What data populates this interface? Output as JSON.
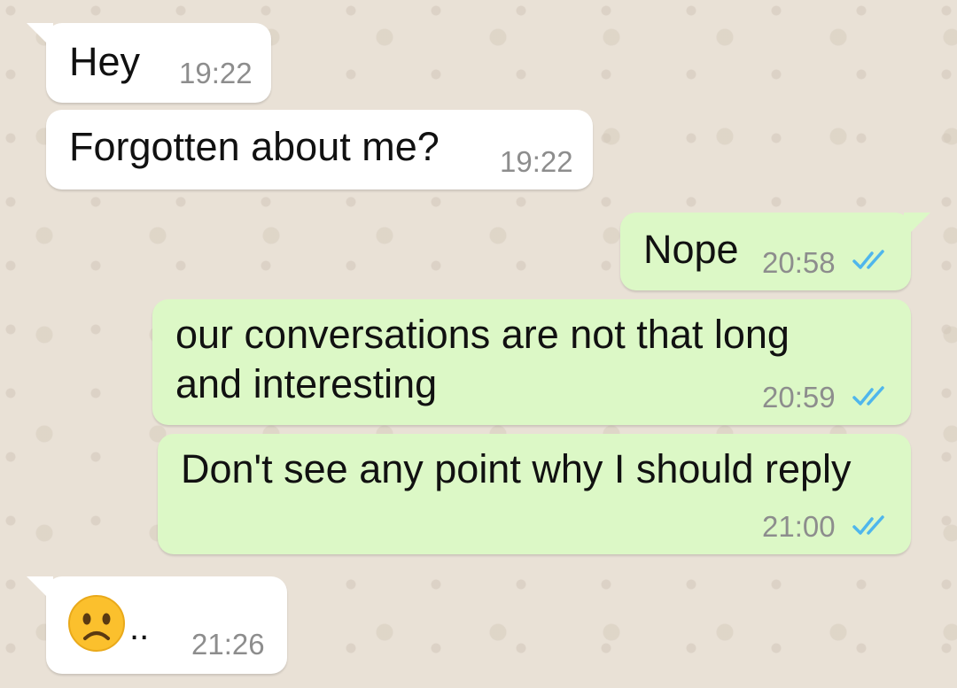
{
  "chat": {
    "messages": [
      {
        "text": "Hey",
        "time": "19:22",
        "direction": "incoming"
      },
      {
        "text": "Forgotten about me?",
        "time": "19:22",
        "direction": "incoming"
      },
      {
        "text": "Nope",
        "time": "20:58",
        "direction": "outgoing",
        "status": "read"
      },
      {
        "text": "our conversations are not that long and interesting",
        "time": "20:59",
        "direction": "outgoing",
        "status": "read"
      },
      {
        "text": "Don't see any point why I should reply",
        "time": "21:00",
        "direction": "outgoing",
        "status": "read"
      },
      {
        "text": "..",
        "emoji": "worried-face-emoji",
        "time": "21:26",
        "direction": "incoming"
      }
    ]
  },
  "colors": {
    "wallpaper": "#e9e1d6",
    "incoming_bubble": "#ffffff",
    "outgoing_bubble": "#dcf8c6",
    "read_ticks": "#4fb6ec",
    "timestamp": "#8d8d8d"
  },
  "icons": {
    "read_receipt": "double-check-icon"
  }
}
